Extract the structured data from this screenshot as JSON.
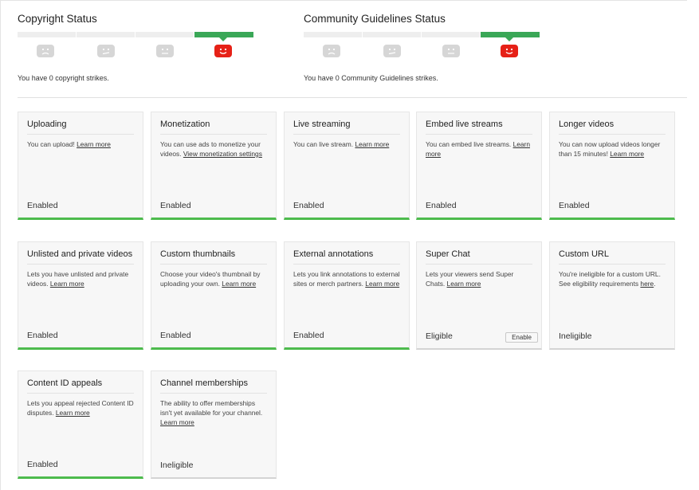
{
  "copyright": {
    "title": "Copyright Status",
    "strikes_text": "You have 0 copyright strikes.",
    "face_icons": [
      "sad-face-icon",
      "meh-face-icon",
      "neutral-face-icon",
      "happy-face-icon"
    ]
  },
  "guidelines": {
    "title": "Community Guidelines Status",
    "strikes_text": "You have 0 Community Guidelines strikes.",
    "face_icons": [
      "sad-face-icon",
      "meh-face-icon",
      "neutral-face-icon",
      "happy-face-icon"
    ]
  },
  "colors": {
    "green": "#3aa757",
    "red": "#e62117",
    "grey_face": "#d6d6d6"
  },
  "features": [
    {
      "title": "Uploading",
      "desc": "You can upload! ",
      "link": "Learn more",
      "status": "Enabled"
    },
    {
      "title": "Monetization",
      "desc": "You can use ads to monetize your videos. ",
      "link": "View monetization settings",
      "status": "Enabled"
    },
    {
      "title": "Live streaming",
      "desc": "You can live stream. ",
      "link": "Learn more",
      "status": "Enabled"
    },
    {
      "title": "Embed live streams",
      "desc": "You can embed live streams. ",
      "link": "Learn more",
      "status": "Enabled"
    },
    {
      "title": "Longer videos",
      "desc": "You can now upload videos longer than 15 minutes! ",
      "link": "Learn more",
      "status": "Enabled"
    },
    {
      "title": "Unlisted and private videos",
      "desc": "Lets you have unlisted and private videos. ",
      "link": "Learn more",
      "status": "Enabled"
    },
    {
      "title": "Custom thumbnails",
      "desc": "Choose your video's thumbnail by uploading your own. ",
      "link": "Learn more",
      "status": "Enabled"
    },
    {
      "title": "External annotations",
      "desc": "Lets you link annotations to external sites or merch partners. ",
      "link": "Learn more",
      "status": "Enabled"
    },
    {
      "title": "Super Chat",
      "desc": "Lets your viewers send Super Chats. ",
      "link": "Learn more",
      "status": "Eligible",
      "button": "Enable"
    },
    {
      "title": "Custom URL",
      "desc": "You're ineligible for a custom URL. See eligibility requirements ",
      "link": "here",
      "link_suffix": ".",
      "status": "Ineligible"
    },
    {
      "title": "Content ID appeals",
      "desc": "Lets you appeal rejected Content ID disputes. ",
      "link": "Learn more",
      "status": "Enabled"
    },
    {
      "title": "Channel memberships",
      "desc": "The ability to offer memberships isn't yet available for your channel. ",
      "link": "Learn more",
      "status": "Ineligible"
    }
  ]
}
